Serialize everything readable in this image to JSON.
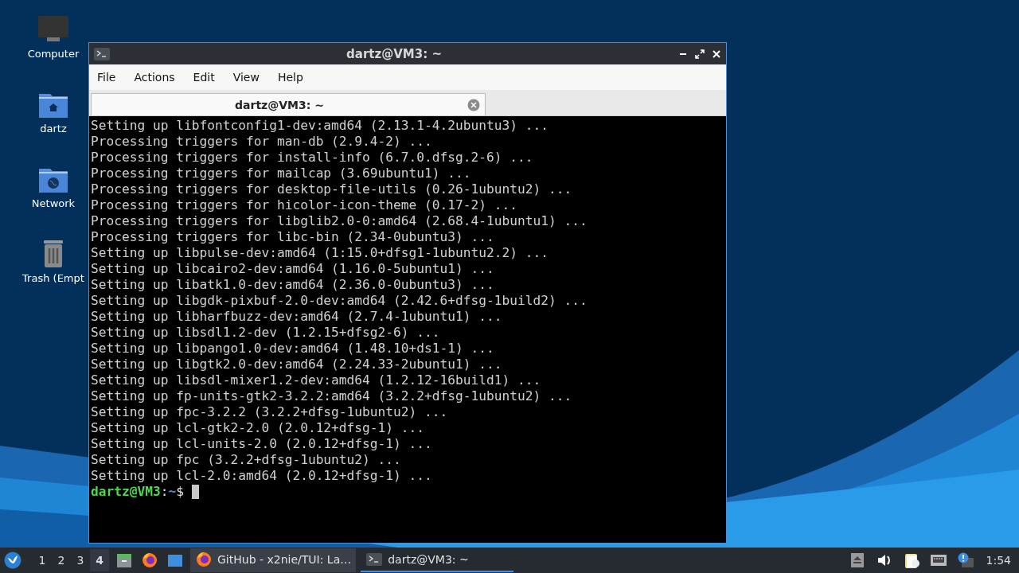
{
  "desktop_icons": [
    {
      "kind": "computer",
      "label": "Computer"
    },
    {
      "kind": "home",
      "label": "dartz"
    },
    {
      "kind": "network",
      "label": "Network"
    },
    {
      "kind": "trash",
      "label": "Trash (Empt"
    }
  ],
  "window": {
    "title": "dartz@VM3: ~",
    "menu": [
      "File",
      "Actions",
      "Edit",
      "View",
      "Help"
    ],
    "tabs": [
      {
        "label": "dartz@VM3: ~",
        "selected": true
      }
    ],
    "terminal": {
      "lines": [
        "Setting up libfontconfig1-dev:amd64 (2.13.1-4.2ubuntu3) ...",
        "Processing triggers for man-db (2.9.4-2) ...",
        "Processing triggers for install-info (6.7.0.dfsg.2-6) ...",
        "Processing triggers for mailcap (3.69ubuntu1) ...",
        "Processing triggers for desktop-file-utils (0.26-1ubuntu2) ...",
        "Processing triggers for hicolor-icon-theme (0.17-2) ...",
        "Processing triggers for libglib2.0-0:amd64 (2.68.4-1ubuntu1) ...",
        "Processing triggers for libc-bin (2.34-0ubuntu3) ...",
        "Setting up libpulse-dev:amd64 (1:15.0+dfsg1-1ubuntu2.2) ...",
        "Setting up libcairo2-dev:amd64 (1.16.0-5ubuntu1) ...",
        "Setting up libatk1.0-dev:amd64 (2.36.0-0ubuntu3) ...",
        "Setting up libgdk-pixbuf-2.0-dev:amd64 (2.42.6+dfsg-1build2) ...",
        "Setting up libharfbuzz-dev:amd64 (2.7.4-1ubuntu1) ...",
        "Setting up libsdl1.2-dev (1.2.15+dfsg2-6) ...",
        "Setting up libpango1.0-dev:amd64 (1.48.10+ds1-1) ...",
        "Setting up libgtk2.0-dev:amd64 (2.24.33-2ubuntu1) ...",
        "Setting up libsdl-mixer1.2-dev:amd64 (1.2.12-16build1) ...",
        "Setting up fp-units-gtk2-3.2.2:amd64 (3.2.2+dfsg-1ubuntu2) ...",
        "Setting up fpc-3.2.2 (3.2.2+dfsg-1ubuntu2) ...",
        "Setting up lcl-gtk2-2.0 (2.0.12+dfsg-1) ...",
        "Setting up lcl-units-2.0 (2.0.12+dfsg-1) ...",
        "Setting up fpc (3.2.2+dfsg-1ubuntu2) ...",
        "Setting up lcl-2.0:amd64 (2.0.12+dfsg-1) ..."
      ],
      "prompt": {
        "user_host": "dartz@VM3",
        "separator": ":",
        "path": "~",
        "symbol": "$"
      }
    }
  },
  "taskbar": {
    "workspaces": [
      {
        "label": "1",
        "selected": false
      },
      {
        "label": "2",
        "selected": false
      },
      {
        "label": "3",
        "selected": false
      },
      {
        "label": "4",
        "selected": true
      }
    ],
    "tasks": [
      {
        "kind": "firefox",
        "label": "GitHub - x2nie/TUI: La…",
        "selected": false,
        "hovered": true
      },
      {
        "kind": "terminal",
        "label": "dartz@VM3: ~",
        "selected": true,
        "hovered": false
      }
    ],
    "clock": "1:54"
  }
}
